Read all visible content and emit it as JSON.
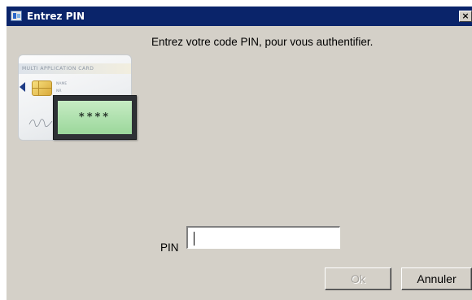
{
  "window": {
    "title": "Entrez PIN",
    "close_glyph": "×",
    "title_icon": "smartcard-app-icon"
  },
  "dialog": {
    "instruction": "Entrez votre code PIN, pour vous authentifier."
  },
  "illustration": {
    "card_heading": "MULTI APPLICATION CARD",
    "card_name": "NAME",
    "card_nr": "NR",
    "pin_stars": "****",
    "icon": "smartcard-with-pin-reader-illustration"
  },
  "form": {
    "pin_label": "PIN",
    "pin_value": ""
  },
  "buttons": {
    "ok_label": "Ok",
    "ok_enabled": false,
    "cancel_label": "Annuler"
  },
  "colors": {
    "titlebar": "#0a246a",
    "dialog_background": "#d4d0c8",
    "pin_display": "#9bd79b"
  }
}
